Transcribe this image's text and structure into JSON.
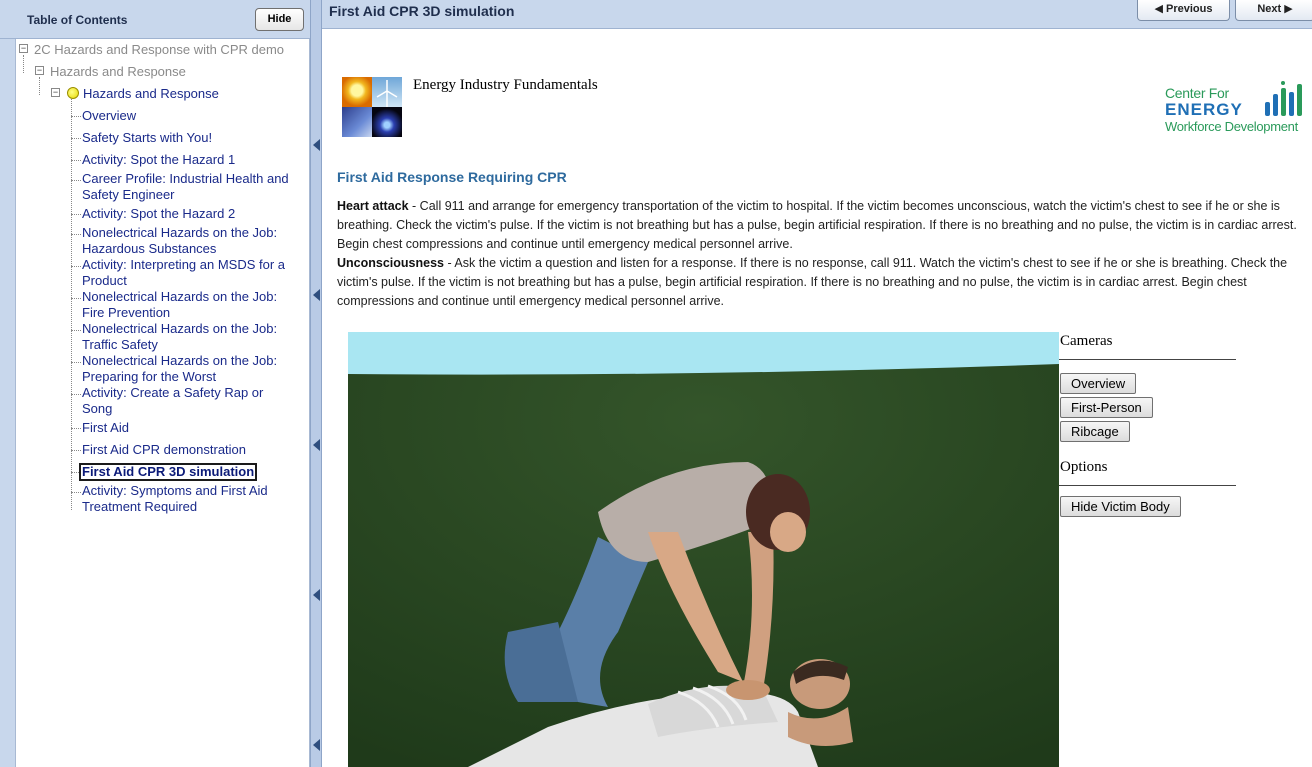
{
  "sidebar": {
    "title": "Table of Contents",
    "hide_label": "Hide",
    "items": [
      {
        "label": "2C Hazards and Response with CPR demo"
      },
      {
        "label": "Hazards and Response"
      },
      {
        "label": "Hazards and Response"
      },
      {
        "label": "Overview"
      },
      {
        "label": "Safety Starts with You!"
      },
      {
        "label": "Activity: Spot the Hazard 1"
      },
      {
        "label": "Career Profile: Industrial Health and Safety Engineer"
      },
      {
        "label": "Activity: Spot the Hazard 2"
      },
      {
        "label": "Nonelectrical Hazards on the Job: Hazardous Substances"
      },
      {
        "label": "Activity: Interpreting an MSDS for a Product"
      },
      {
        "label": "Nonelectrical Hazards on the Job: Fire Prevention"
      },
      {
        "label": "Nonelectrical Hazards on the Job: Traffic Safety"
      },
      {
        "label": "Nonelectrical Hazards on the Job: Preparing for the Worst"
      },
      {
        "label": "Activity: Create a Safety Rap or Song"
      },
      {
        "label": "First Aid"
      },
      {
        "label": "First Aid CPR demonstration"
      },
      {
        "label": "First Aid CPR 3D simulation"
      },
      {
        "label": "Activity: Symptoms and First Aid Treatment Required"
      }
    ]
  },
  "header": {
    "title": "First Aid CPR 3D simulation",
    "previous_label": "◀ Previous",
    "next_label": "Next ▶"
  },
  "content": {
    "course_title": "Energy Industry Fundamentals",
    "logo": {
      "line1": "Center For",
      "line2": "ENERGY",
      "line3": "Workforce Development"
    },
    "section_heading": "First Aid Response Requiring CPR",
    "heart_attack_term": "Heart attack",
    "heart_attack_text": " - Call 911 and arrange for emergency transportation of the victim to hospital. If the victim becomes unconscious, watch the victim's chest to see if he or she is breathing. Check the victim's pulse. If the victim is not breathing but has a pulse, begin artificial respiration. If there is no breathing and no pulse, the victim is in cardiac arrest. Begin chest compressions and continue until emergency medical personnel arrive.",
    "unconsciousness_term": "Unconsciousness",
    "unconsciousness_text": " - Ask the victim a question and listen for a response. If there is no response, call 911. Watch the victim's chest to see if he or she is breathing. Check the victim's pulse. If the victim is not breathing but has a pulse, begin artificial respiration. If there is no breathing and no pulse, the victim is in cardiac arrest. Begin chest compressions and continue until emergency medical personnel arrive."
  },
  "controls": {
    "cameras_heading": "Cameras",
    "camera_buttons": [
      "Overview",
      "First-Person",
      "Ribcage"
    ],
    "options_heading": "Options",
    "option_buttons": [
      "Hide Victim Body"
    ]
  },
  "colors": {
    "chrome": "#c8d7ec",
    "link": "#1a2a8a",
    "heading": "#2e6a9e",
    "sky": "#a9e6f2",
    "ground": "#2f4d24"
  },
  "icons": [
    "bulb-icon",
    "expander-minus-icon",
    "collapse-arrow-icon"
  ]
}
